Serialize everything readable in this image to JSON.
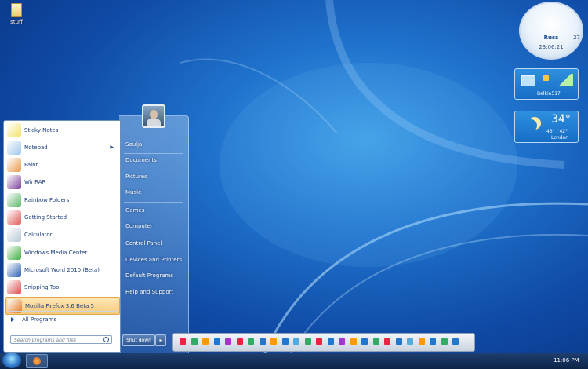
{
  "desktop": {
    "icon_label": "stuff"
  },
  "start_menu": {
    "programs": [
      {
        "label": "Sticky Notes",
        "icon": "sticky-notes-icon",
        "color": "#f3e36a"
      },
      {
        "label": "Notepad",
        "icon": "notepad-icon",
        "color": "#9fc7ea",
        "has_submenu": true
      },
      {
        "label": "Paint",
        "icon": "paint-icon",
        "color": "#e79a4d"
      },
      {
        "label": "WinRAR",
        "icon": "winrar-icon",
        "color": "#7a3f9a"
      },
      {
        "label": "Rainbow Folders",
        "icon": "rainbow-folders-icon",
        "color": "#5bb76a"
      },
      {
        "label": "Getting Started",
        "icon": "getting-started-icon",
        "color": "#e05a5a"
      },
      {
        "label": "Calculator",
        "icon": "calculator-icon",
        "color": "#b9c7d6"
      },
      {
        "label": "Windows Media Center",
        "icon": "media-center-icon",
        "color": "#3fae3f"
      },
      {
        "label": "Microsoft Word 2010 (Beta)",
        "icon": "word-icon",
        "color": "#2b5fb3"
      },
      {
        "label": "Snipping Tool",
        "icon": "snipping-tool-icon",
        "color": "#d84b4b"
      },
      {
        "label": "Mozilla Firefox 3.6 Beta 5",
        "icon": "firefox-icon",
        "color": "#e2771f",
        "highlighted": true
      }
    ],
    "all_programs": "All Programs",
    "search_placeholder": "Search programs and files",
    "right_links": [
      "Soulja",
      "Documents",
      "Pictures",
      "Music",
      "Games",
      "Computer",
      "Control Panel",
      "Devices and Printers",
      "Default Programs",
      "Help and Support"
    ],
    "shutdown_label": "Shut down",
    "shutdown_arrow": "▸"
  },
  "gadgets": {
    "clock": {
      "brand": "Russ",
      "time": "23:06:21",
      "num": "27"
    },
    "network": {
      "name": "Belkin517"
    },
    "weather": {
      "temp": "34°",
      "range": "43° / 42°",
      "city": "London"
    }
  },
  "taskbar": {
    "time": "11:06 PM"
  }
}
